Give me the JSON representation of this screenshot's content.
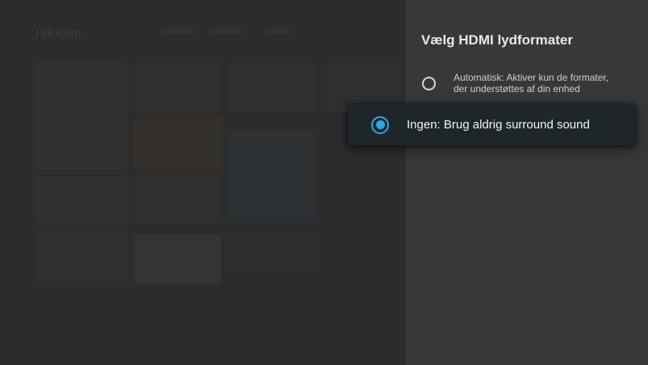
{
  "background_app": {
    "logo": "rakuten"
  },
  "panel": {
    "title": "Vælg HDMI lydformater",
    "options": [
      {
        "label": "Automatisk: Aktiver kun de formater, der understøttes af din enhed",
        "selected": false
      },
      {
        "label": "Ingen: Brug aldrig surround sound",
        "selected": true
      }
    ]
  },
  "colors": {
    "accent": "#2da7e6",
    "panel_bg": "#383838",
    "selected_bg": "#1f262a"
  }
}
